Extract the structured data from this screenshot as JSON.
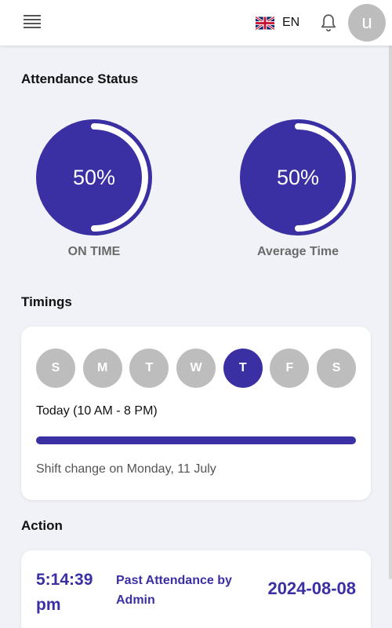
{
  "header": {
    "language_code": "EN",
    "avatar_initial": "u"
  },
  "attendance": {
    "title": "Attendance Status",
    "gauges": [
      {
        "value": "50%",
        "label": "ON TIME",
        "fraction": 0.5
      },
      {
        "value": "50%",
        "label": "Average Time",
        "fraction": 0.5
      }
    ]
  },
  "timings": {
    "title": "Timings",
    "days": [
      "S",
      "M",
      "T",
      "W",
      "T",
      "F",
      "S"
    ],
    "active_day_index": 4,
    "today_text": "Today (10 AM - 8 PM)",
    "progress_fraction": 1.0,
    "shift_text": "Shift change on Monday, 11 July"
  },
  "action": {
    "title": "Action",
    "entries": [
      {
        "time": "5:14:39 pm",
        "label": "Past Attendance by Admin",
        "date": "2024-08-08"
      }
    ]
  },
  "colors": {
    "accent": "#3a2fa3",
    "inactive_day": "#bdbdbd",
    "background": "#f0f2f7"
  }
}
